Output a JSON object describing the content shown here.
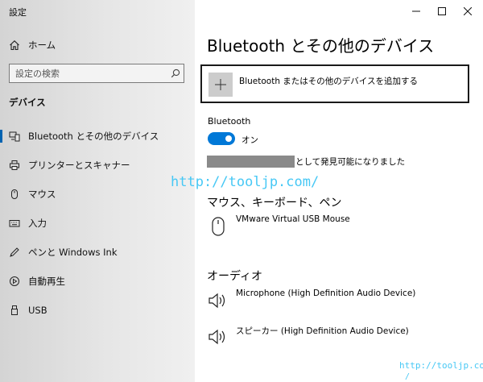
{
  "window": {
    "title": "設定"
  },
  "sidebar": {
    "home_label": "ホーム",
    "search_placeholder": "設定の検索",
    "section_label": "デバイス",
    "items": [
      {
        "label": "Bluetooth とその他のデバイス",
        "icon": "bluetooth-devices-icon",
        "active": true
      },
      {
        "label": "プリンターとスキャナー",
        "icon": "printer-icon"
      },
      {
        "label": "マウス",
        "icon": "mouse-icon"
      },
      {
        "label": "入力",
        "icon": "keyboard-icon"
      },
      {
        "label": "ペンと Windows Ink",
        "icon": "pen-icon"
      },
      {
        "label": "自動再生",
        "icon": "autoplay-icon"
      },
      {
        "label": "USB",
        "icon": "usb-icon"
      }
    ]
  },
  "main": {
    "title": "Bluetooth とその他のデバイス",
    "add_device_label": "Bluetooth またはその他のデバイスを追加する",
    "bluetooth_label": "Bluetooth",
    "toggle_state": "オン",
    "discoverable_text": "として発見可能になりました",
    "groups": {
      "mouse_keyboard_pen": {
        "title": "マウス、キーボード、ペン",
        "devices": [
          {
            "name": "VMware Virtual USB Mouse",
            "icon": "mouse-icon"
          }
        ]
      },
      "audio": {
        "title": "オーディオ",
        "devices": [
          {
            "name": "Microphone (High Definition Audio Device)",
            "icon": "speaker-icon"
          },
          {
            "name": "スピーカー (High Definition Audio Device)",
            "icon": "speaker-icon"
          }
        ]
      }
    }
  },
  "watermark": {
    "primary": "http://tooljp.com/",
    "secondary": "http://tooljp.com",
    "secondary_tail": "/"
  },
  "colors": {
    "accent": "#0078d7",
    "selection_bar": "#0063b1",
    "watermark": "#47c8f5"
  }
}
